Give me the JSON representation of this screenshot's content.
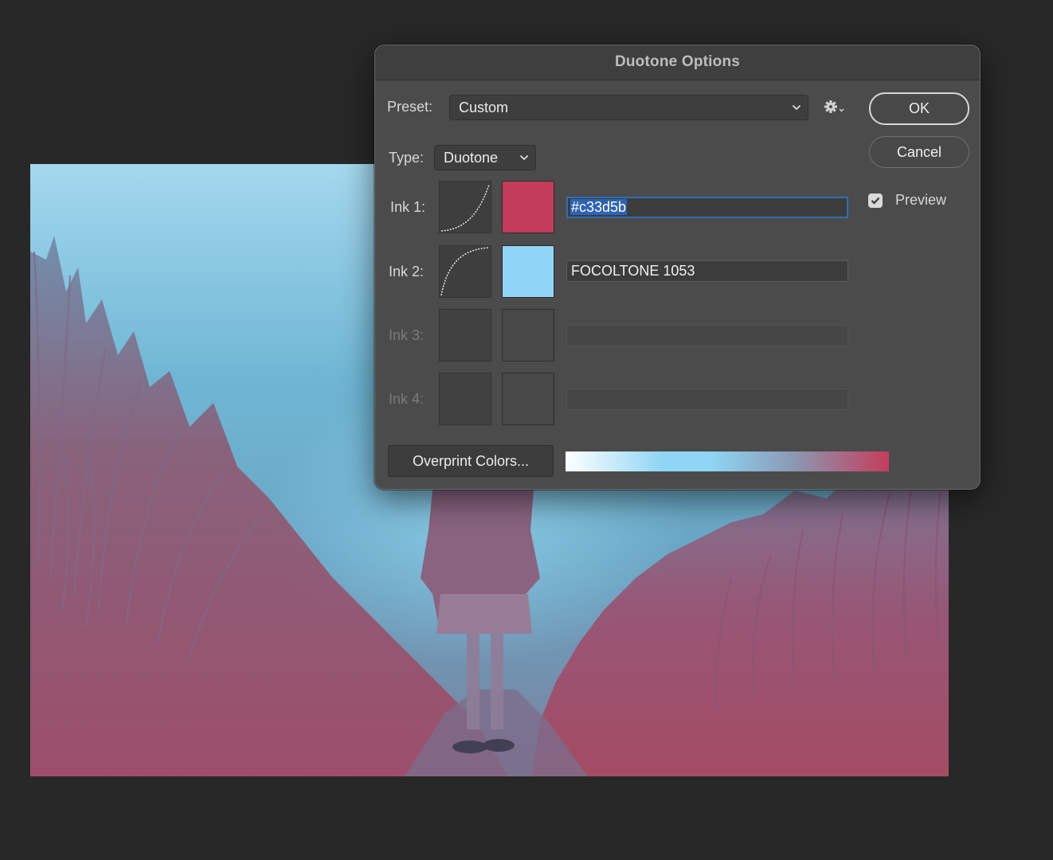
{
  "dialog": {
    "title": "Duotone Options",
    "preset": {
      "label": "Preset:",
      "value": "Custom"
    },
    "type": {
      "label": "Type:",
      "value": "Duotone"
    },
    "buttons": {
      "ok": "OK",
      "cancel": "Cancel",
      "overprint": "Overprint Colors..."
    },
    "preview": {
      "label": "Preview",
      "checked": true
    },
    "inks": [
      {
        "label": "Ink 1:",
        "color": "#c33d5b",
        "name": "#c33d5b",
        "enabled": true,
        "selected": true
      },
      {
        "label": "Ink 2:",
        "color": "#8fd5f5",
        "name": "FOCOLTONE 1053",
        "enabled": true,
        "selected": false
      },
      {
        "label": "Ink 3:",
        "color": "",
        "name": "",
        "enabled": false
      },
      {
        "label": "Ink 4:",
        "color": "",
        "name": "",
        "enabled": false
      }
    ],
    "gradient_colors": [
      "#ffffff",
      "#8fd5f5",
      "#c33d5b"
    ]
  },
  "icons": {
    "gear": "gear-icon",
    "chevron": "chevron-down-icon",
    "checkmark": "checkmark-icon",
    "curve": "curve-icon"
  }
}
